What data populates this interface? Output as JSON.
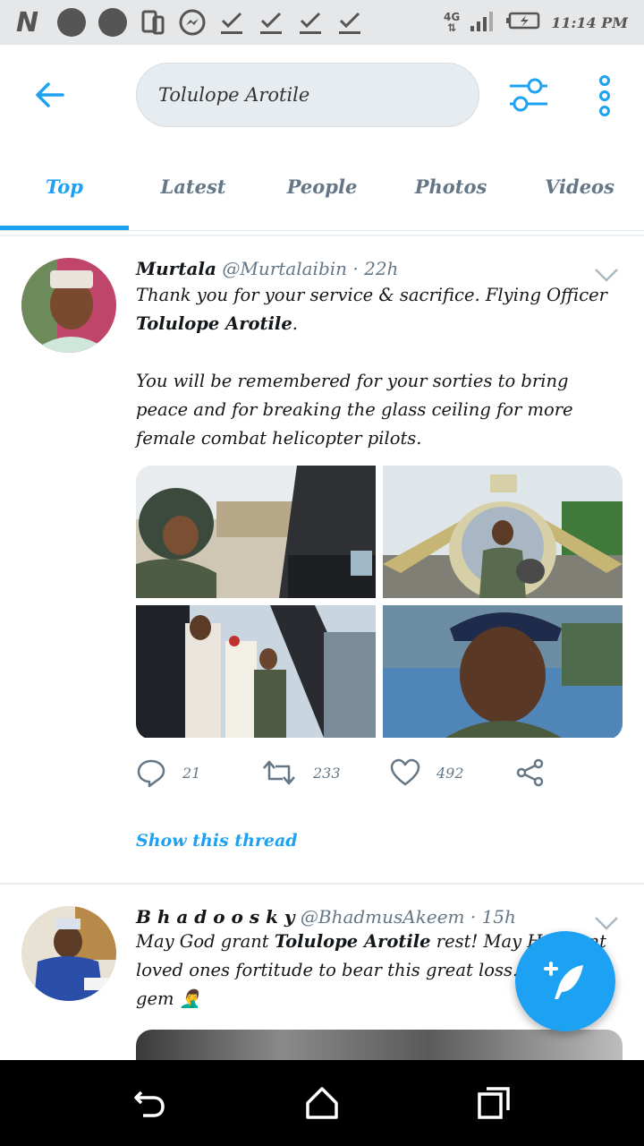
{
  "status_bar": {
    "time": "11:14 PM",
    "network": "4G",
    "icons": [
      "netflix-n-icon",
      "notification-dot-icon",
      "notification-dot-icon",
      "sim-icon",
      "messenger-icon",
      "check-icon",
      "check-icon",
      "check-icon",
      "check-icon",
      "signal-icon",
      "battery-charging-icon"
    ]
  },
  "header": {
    "search_value": "Tolulope Arotile"
  },
  "tabs": [
    {
      "label": "Top",
      "active": true
    },
    {
      "label": "Latest",
      "active": false
    },
    {
      "label": "People",
      "active": false
    },
    {
      "label": "Photos",
      "active": false
    },
    {
      "label": "Videos",
      "active": false
    }
  ],
  "tweets": [
    {
      "name": "Murtala",
      "handle": "@Murtalaibin",
      "time": "· 22h",
      "text_1": "Thank you for your service & sacrifice. Flying Officer ",
      "text_bold": "Tolulope Arotile",
      "text_2": ".",
      "text_para2": "You will be remembered for your sorties to bring peace and for breaking the glass ceiling for more female combat helicopter pilots.",
      "replies": "21",
      "retweets": "233",
      "likes": "492",
      "show_thread": "Show this thread"
    },
    {
      "name": "B h a d o o s k y",
      "handle": "@BhadmusAkeem",
      "time": "· 15h",
      "text_1": "May God grant ",
      "text_bold": "Tolulope Arotile",
      "text_2": " rest! May He grant",
      "text_line2": "loved ones fortitude to bear this great loss. We just",
      "text_line3": "gem 🤦‍♂️"
    }
  ],
  "colors": {
    "accent": "#1da1f2",
    "text_muted": "#657786",
    "status_bar_bg": "#e6e7e8"
  }
}
